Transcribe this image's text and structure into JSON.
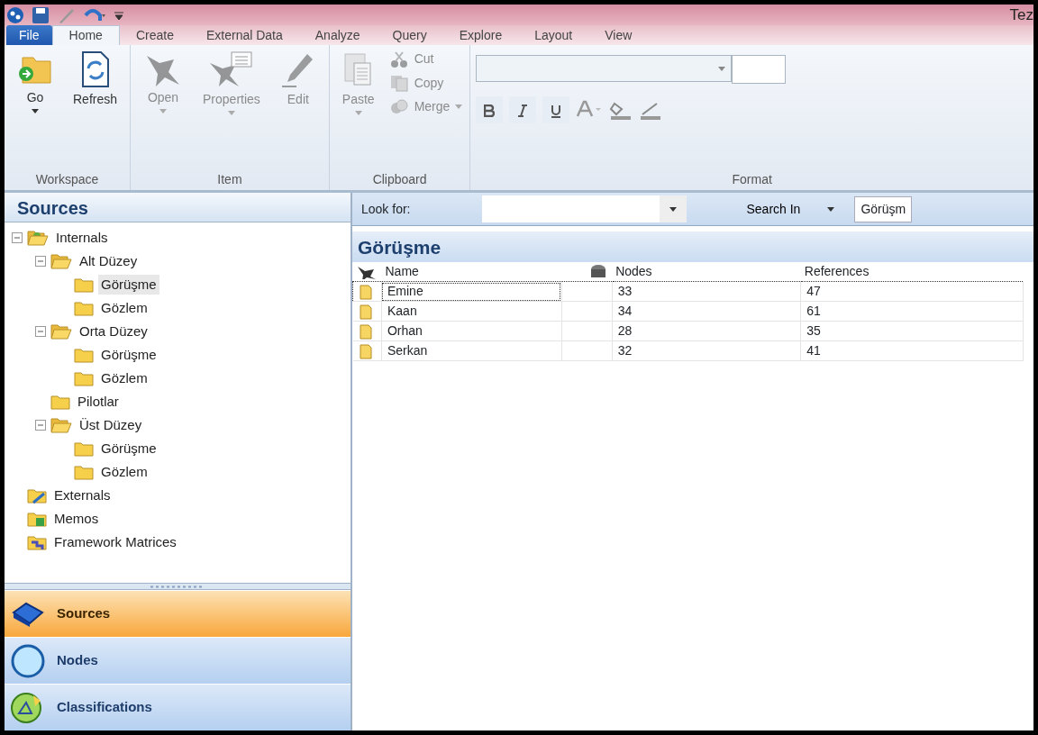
{
  "window": {
    "title": "Tez"
  },
  "ribbon_tabs": [
    {
      "label": "File",
      "kind": "file",
      "selected": false
    },
    {
      "label": "Home",
      "kind": "tab",
      "selected": true
    },
    {
      "label": "Create",
      "kind": "tab",
      "selected": false
    },
    {
      "label": "External Data",
      "kind": "tab",
      "selected": false
    },
    {
      "label": "Analyze",
      "kind": "tab",
      "selected": false
    },
    {
      "label": "Query",
      "kind": "tab",
      "selected": false
    },
    {
      "label": "Explore",
      "kind": "tab",
      "selected": false
    },
    {
      "label": "Layout",
      "kind": "tab",
      "selected": false
    },
    {
      "label": "View",
      "kind": "tab",
      "selected": false
    }
  ],
  "ribbon_groups": [
    {
      "label": "Workspace",
      "kind": "buttons",
      "buttons": [
        {
          "label": "Go",
          "disabled": false,
          "dropdown": true
        },
        {
          "label": "Refresh",
          "disabled": false,
          "dropdown": false
        }
      ]
    },
    {
      "label": "Item",
      "kind": "buttons",
      "buttons": [
        {
          "label": "Open",
          "disabled": true,
          "dropdown": true
        },
        {
          "label": "Properties",
          "disabled": true,
          "dropdown": true
        },
        {
          "label": "Edit",
          "disabled": true,
          "dropdown": false
        }
      ]
    },
    {
      "label": "Clipboard",
      "kind": "buttons",
      "buttons": [
        {
          "label": "Paste",
          "disabled": true,
          "dropdown": true
        }
      ],
      "small_buttons": [
        {
          "label": "Cut",
          "disabled": true,
          "dropdown": false
        },
        {
          "label": "Copy",
          "disabled": true,
          "dropdown": false
        },
        {
          "label": "Merge",
          "disabled": true,
          "dropdown": true
        }
      ]
    },
    {
      "label": "Format",
      "kind": "format"
    }
  ],
  "sources_panel": {
    "title": "Sources",
    "tree": [
      {
        "label": "Internals",
        "expanded": true,
        "selected": false,
        "children": [
          {
            "label": "Alt Düzey",
            "expanded": true,
            "selected": false,
            "children": [
              {
                "label": "Görüşme",
                "selected": true
              },
              {
                "label": "Gözlem",
                "selected": false
              }
            ]
          },
          {
            "label": "Orta Düzey",
            "expanded": true,
            "selected": false,
            "children": [
              {
                "label": "Görüşme",
                "selected": false
              },
              {
                "label": "Gözlem",
                "selected": false
              }
            ]
          },
          {
            "label": "Pilotlar",
            "selected": false
          },
          {
            "label": "Üst Düzey",
            "expanded": true,
            "selected": false,
            "children": [
              {
                "label": "Görüşme",
                "selected": false
              },
              {
                "label": "Gözlem",
                "selected": false
              }
            ]
          }
        ]
      },
      {
        "label": "Externals",
        "selected": false
      },
      {
        "label": "Memos",
        "selected": false
      },
      {
        "label": "Framework Matrices",
        "selected": false
      }
    ]
  },
  "navigation": [
    {
      "label": "Sources",
      "selected": true
    },
    {
      "label": "Nodes",
      "selected": false
    },
    {
      "label": "Classifications",
      "selected": false
    }
  ],
  "find_bar": {
    "look_for_label": "Look for:",
    "search_in_label": "Search In",
    "search_in_value": "Görüşm"
  },
  "list_view": {
    "title": "Görüşme",
    "columns": [
      "Name",
      "Nodes",
      "References"
    ],
    "rows": [
      {
        "cells": [
          "Emine",
          "33",
          "47"
        ],
        "selected": true
      },
      {
        "cells": [
          "Kaan",
          "34",
          "61"
        ],
        "selected": false
      },
      {
        "cells": [
          "Orhan",
          "28",
          "35"
        ],
        "selected": false
      },
      {
        "cells": [
          "Serkan",
          "32",
          "41"
        ],
        "selected": false
      }
    ]
  }
}
